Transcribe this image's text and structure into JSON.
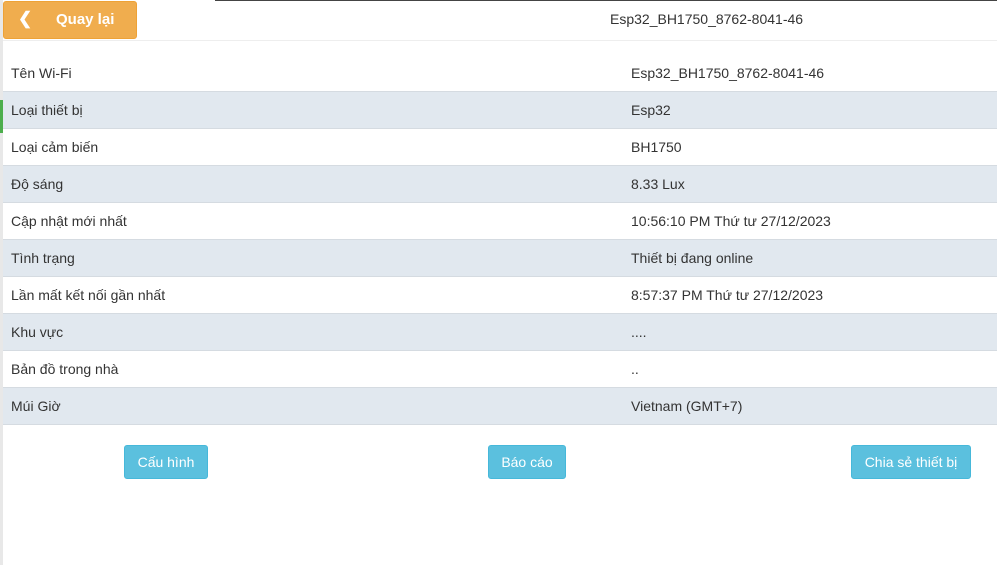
{
  "header": {
    "back_label": "Quay lại",
    "title": "Esp32_BH1750_8762-8041-46"
  },
  "rows": [
    {
      "label": "Tên Wi-Fi",
      "value": "Esp32_BH1750_8762-8041-46"
    },
    {
      "label": "Loại thiết bị",
      "value": "Esp32"
    },
    {
      "label": "Loại cảm biến",
      "value": "BH1750"
    },
    {
      "label": "Độ sáng",
      "value": "8.33 Lux"
    },
    {
      "label": "Cập nhật mới nhất",
      "value": "10:56:10 PM Thứ tư 27/12/2023"
    },
    {
      "label": "Tình trạng",
      "value": "Thiết bị đang online"
    },
    {
      "label": "Lần mất kết nối gần nhất",
      "value": "8:57:37 PM Thứ tư 27/12/2023"
    },
    {
      "label": "Khu vực",
      "value": "...."
    },
    {
      "label": "Bản đồ trong nhà",
      "value": ".."
    },
    {
      "label": "Múi Giờ",
      "value": "Vietnam (GMT+7)"
    }
  ],
  "actions": {
    "configure": "Cấu hình",
    "report": "Báo cáo",
    "share": "Chia sẻ thiết bị"
  },
  "colors": {
    "back": "#f0ad4e",
    "action": "#5bc0de",
    "row_alt": "#e1e8ef"
  }
}
